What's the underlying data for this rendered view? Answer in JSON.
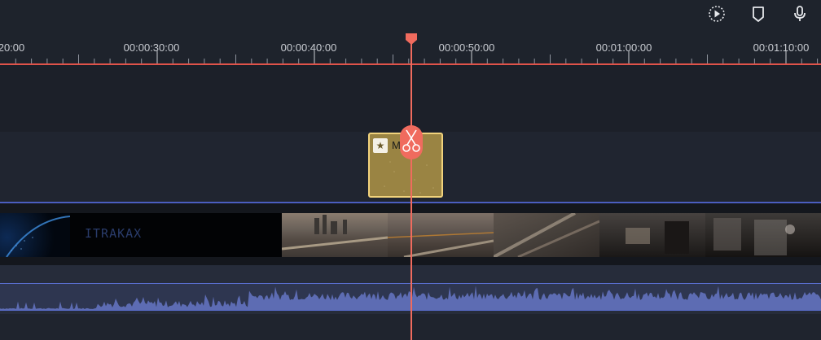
{
  "toolbar": {
    "render_icon": "render-preview-icon",
    "marker_icon": "marker-icon",
    "mic_icon": "microphone-icon"
  },
  "ruler": {
    "labels": [
      "20:00",
      "00:00:30:00",
      "00:00:40:00",
      "00:00:50:00",
      "00:01:00:00",
      "00:01:10:00"
    ]
  },
  "tracks": {
    "title_clip": {
      "label": "Movie",
      "icon": "star-icon",
      "color": "#9a8443"
    },
    "video_clip": {
      "overlay_text": "ITRAKAX"
    }
  },
  "playhead": {
    "color": "#f06b5e",
    "tool_icon": "scissors-icon"
  }
}
